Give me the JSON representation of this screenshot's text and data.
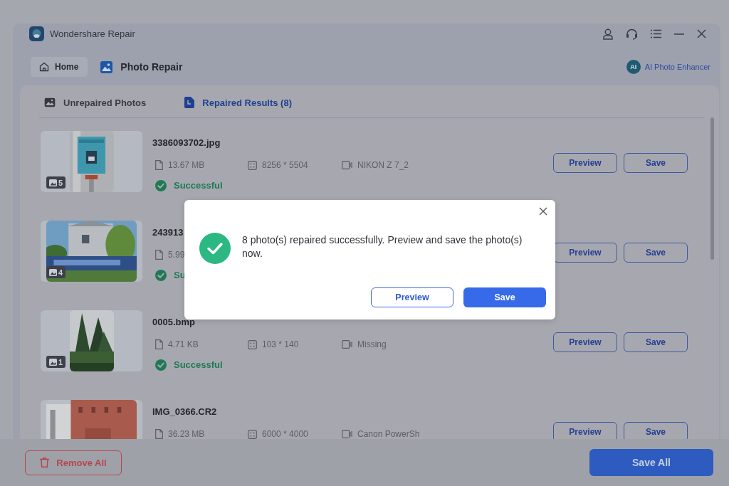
{
  "window": {
    "title": "Wondershare Repair"
  },
  "nav": {
    "home": "Home",
    "page_title": "Photo Repair",
    "ai_badge": "AI",
    "enhancer_link": "AI Photo Enhancer"
  },
  "tabs": [
    {
      "label": "Unrepaired Photos",
      "selected": false
    },
    {
      "label": "Repaired Results (8)",
      "selected": true
    }
  ],
  "results": [
    {
      "name": "3386093702.jpg",
      "size": "13.67 MB",
      "dimensions": "8256 * 5504",
      "camera": "NIKON Z 7_2",
      "status": "Successful",
      "photo_count": "5",
      "actions": [
        "Preview",
        "Save"
      ]
    },
    {
      "name": "243913",
      "size": "5.99",
      "status": "Su",
      "photo_count": "4",
      "actions": [
        "Preview",
        "Save"
      ]
    },
    {
      "name": "0005.bmp",
      "size": "4.71 KB",
      "dimensions": "103 * 140",
      "camera": "Missing",
      "status": "Successful",
      "photo_count": "1",
      "actions": [
        "Preview",
        "Save"
      ]
    },
    {
      "name": "IMG_0366.CR2",
      "size": "36.23 MB",
      "dimensions": "6000 * 4000",
      "camera": "Canon PowerSh",
      "actions": [
        "Preview",
        "Save"
      ]
    }
  ],
  "footer": {
    "remove_all": "Remove All",
    "save_all": "Save All"
  },
  "dialog": {
    "message": "8 photo(s) repaired successfully. Preview and save the photo(s) now.",
    "buttons": [
      {
        "label": "Preview",
        "kind": "secondary"
      },
      {
        "label": "Save",
        "kind": "primary"
      }
    ]
  }
}
